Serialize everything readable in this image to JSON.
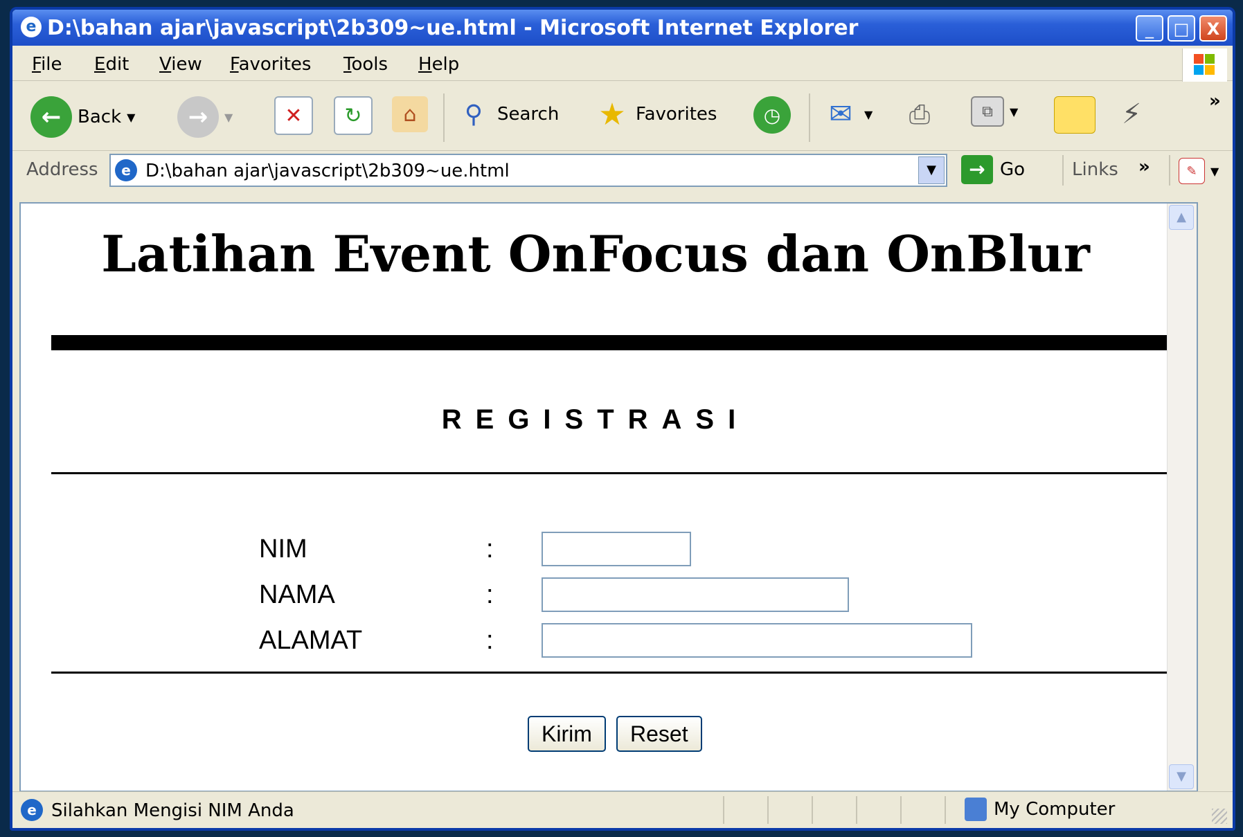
{
  "window": {
    "title": "D:\\bahan ajar\\javascript\\2b309~ue.html - Microsoft Internet Explorer",
    "min_label": "_",
    "max_label": "□",
    "close_label": "X"
  },
  "menu": [
    "File",
    "Edit",
    "View",
    "Favorites",
    "Tools",
    "Help"
  ],
  "toolbar": {
    "back_label": "Back",
    "search_label": "Search",
    "favorites_label": "Favorites",
    "more": "»"
  },
  "address": {
    "label": "Address",
    "url": "D:\\bahan ajar\\javascript\\2b309~ue.html",
    "go_label": "Go",
    "links_label": "Links",
    "links_more": "»"
  },
  "page": {
    "title": "Latihan Event OnFocus dan OnBlur",
    "subtitle": "REGISTRASI",
    "fields": [
      {
        "label": "NIM",
        "colon": ":"
      },
      {
        "label": "NAMA",
        "colon": ":"
      },
      {
        "label": "ALAMAT",
        "colon": ":"
      }
    ],
    "submit_label": "Kirim",
    "reset_label": "Reset"
  },
  "status": {
    "text": "Silahkan Mengisi NIM Anda",
    "zone": "My Computer"
  }
}
